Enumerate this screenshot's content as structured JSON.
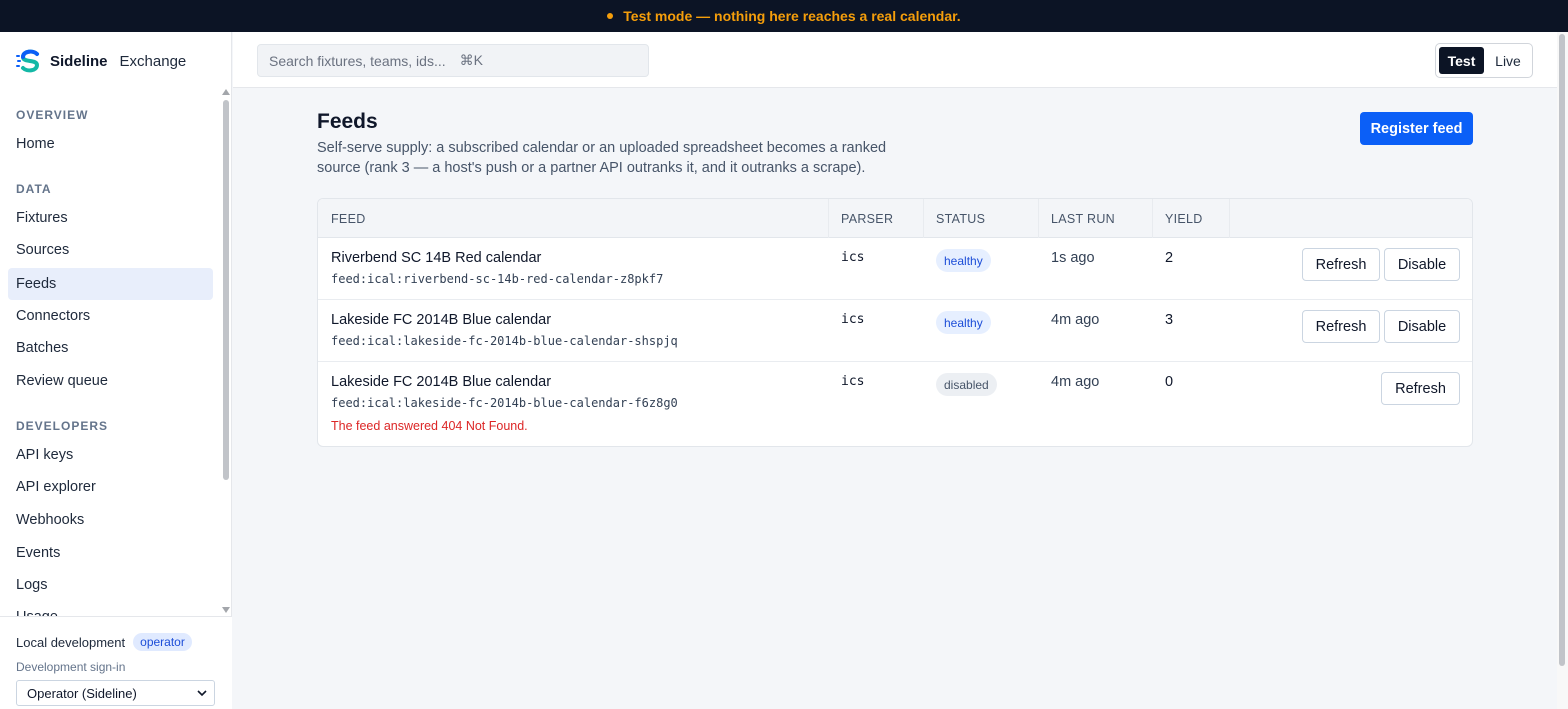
{
  "banner": {
    "text": "Test mode — nothing here reaches a real calendar."
  },
  "brand": {
    "name_bold": "Sideline",
    "name_light": "Exchange"
  },
  "sidebar": {
    "sections": [
      {
        "label": "OVERVIEW",
        "items": [
          "Home"
        ]
      },
      {
        "label": "DATA",
        "items": [
          "Fixtures",
          "Sources",
          "Feeds",
          "Connectors",
          "Batches",
          "Review queue"
        ]
      },
      {
        "label": "DEVELOPERS",
        "items": [
          "API keys",
          "API explorer",
          "Webhooks",
          "Events",
          "Logs",
          "Usage"
        ]
      }
    ],
    "active_item": "Feeds",
    "footer": {
      "environment": "Local development",
      "role_badge": "operator",
      "signin_label": "Development sign-in",
      "signin_value": "Operator (Sideline)"
    }
  },
  "header": {
    "search_placeholder": "Search fixtures, teams, ids...",
    "search_shortcut": "⌘K",
    "mode_options": [
      "Test",
      "Live"
    ],
    "mode_selected": "Test"
  },
  "page": {
    "title": "Feeds",
    "subtitle": "Self-serve supply: a subscribed calendar or an uploaded spreadsheet becomes a ranked source (rank 3 — a host's push or a partner API outranks it, and it outranks a scrape).",
    "primary_action": "Register feed"
  },
  "table": {
    "columns": [
      "FEED",
      "PARSER",
      "STATUS",
      "LAST RUN",
      "YIELD"
    ],
    "rows": [
      {
        "name": "Riverbend SC 14B Red calendar",
        "id": "feed:ical:riverbend-sc-14b-red-calendar-z8pkf7",
        "parser": "ics",
        "status": "healthy",
        "last_run": "1s ago",
        "yield": "2",
        "actions": [
          "Refresh",
          "Disable"
        ],
        "error": ""
      },
      {
        "name": "Lakeside FC 2014B Blue calendar",
        "id": "feed:ical:lakeside-fc-2014b-blue-calendar-shspjq",
        "parser": "ics",
        "status": "healthy",
        "last_run": "4m ago",
        "yield": "3",
        "actions": [
          "Refresh",
          "Disable"
        ],
        "error": ""
      },
      {
        "name": "Lakeside FC 2014B Blue calendar",
        "id": "feed:ical:lakeside-fc-2014b-blue-calendar-f6z8g0",
        "parser": "ics",
        "status": "disabled",
        "last_run": "4m ago",
        "yield": "0",
        "actions": [
          "Refresh"
        ],
        "error": "The feed answered 404 Not Found."
      }
    ]
  },
  "colors": {
    "banner_bg": "#0c1425",
    "banner_text": "#f59e0b",
    "primary": "#0b5ff7",
    "active_nav": "#e8eefb",
    "error": "#dc2626"
  }
}
